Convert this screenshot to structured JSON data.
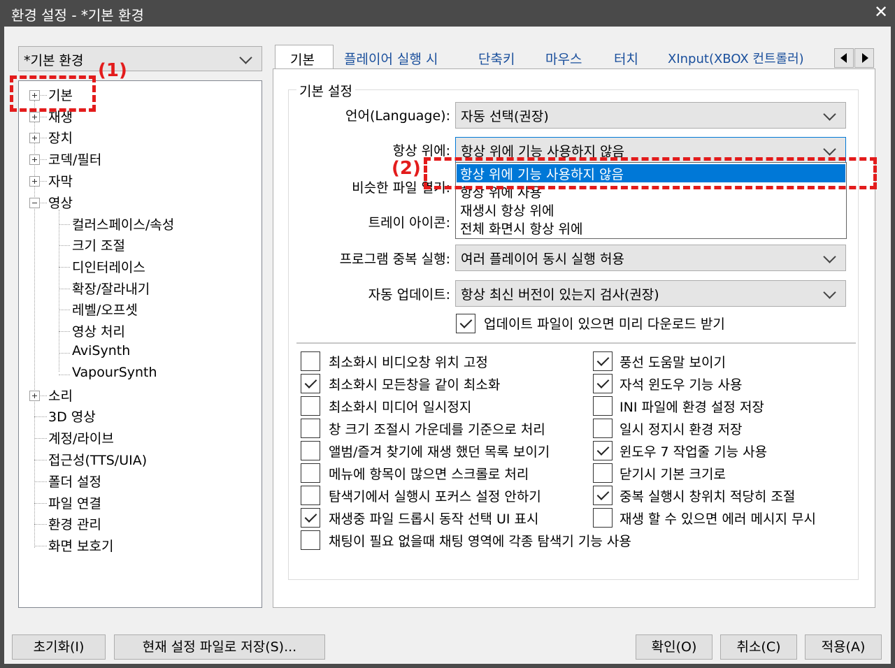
{
  "window": {
    "title": "환경 설정 - *기본 환경",
    "close_glyph": "✕"
  },
  "preset": {
    "value": "*기본 환경"
  },
  "tree": [
    {
      "label": "기본",
      "expander": "plus"
    },
    {
      "label": "재생",
      "expander": "plus"
    },
    {
      "label": "장치",
      "expander": "plus"
    },
    {
      "label": "코덱/필터",
      "expander": "plus"
    },
    {
      "label": "자막",
      "expander": "plus"
    },
    {
      "label": "영상",
      "expander": "minus"
    },
    {
      "label": "컬러스페이스/속성",
      "expander": "none"
    },
    {
      "label": "크기 조절",
      "expander": "none"
    },
    {
      "label": "디인터레이스",
      "expander": "none"
    },
    {
      "label": "확장/잘라내기",
      "expander": "none"
    },
    {
      "label": "레벨/오프셋",
      "expander": "none"
    },
    {
      "label": "영상 처리",
      "expander": "none"
    },
    {
      "label": "AviSynth",
      "expander": "none"
    },
    {
      "label": "VapourSynth",
      "expander": "none"
    },
    {
      "label": "소리",
      "expander": "plus"
    },
    {
      "label": "3D 영상",
      "expander": "none"
    },
    {
      "label": "계정/라이브",
      "expander": "none"
    },
    {
      "label": "접근성(TTS/UIA)",
      "expander": "none"
    },
    {
      "label": "폴더 설정",
      "expander": "none"
    },
    {
      "label": "파일 연결",
      "expander": "none"
    },
    {
      "label": "환경 관리",
      "expander": "none"
    },
    {
      "label": "화면 보호기",
      "expander": "none"
    }
  ],
  "tabs": [
    "기본",
    "플레이어 실행 시",
    "단축키",
    "마우스",
    "터치",
    "XInput(XBOX 컨트롤러)"
  ],
  "active_tab": "기본",
  "group_title": "기본 설정",
  "fields": {
    "language": {
      "label": "언어(Language):",
      "value": "자동 선택(권장)"
    },
    "always_on_top": {
      "label": "항상 위에:",
      "value": "항상 위에 기능 사용하지 않음"
    },
    "similar_files": {
      "label": "비슷한 파일 열기:"
    },
    "tray_icon": {
      "label": "트레이 아이콘:"
    },
    "multi_instance": {
      "label": "프로그램 중복 실행:",
      "value": "여러 플레이어 동시 실행 허용"
    },
    "auto_update": {
      "label": "자동 업데이트:",
      "value": "항상 최신 버전이 있는지 검사(권장)"
    },
    "predownload": {
      "label": "업데이트 파일이 있으면 미리 다운로드 받기",
      "checked": true
    }
  },
  "dropdown": {
    "options": [
      "항상 위에 기능 사용하지 않음",
      "항상 위에 사용",
      "재생시 항상 위에",
      "전체 화면시 항상 위에"
    ],
    "selected": 0
  },
  "checks_left": [
    {
      "label": "최소화시 비디오창 위치 고정",
      "checked": false
    },
    {
      "label": "최소화시 모든창을 같이 최소화",
      "checked": true
    },
    {
      "label": "최소화시 미디어 일시정지",
      "checked": false
    },
    {
      "label": "창 크기 조절시 가운데를 기준으로 처리",
      "checked": false
    },
    {
      "label": "앨범/즐겨 찾기에 재생 했던 목록 보이기",
      "checked": false
    },
    {
      "label": "메뉴에 항목이 많으면 스크롤로 처리",
      "checked": false
    },
    {
      "label": "탐색기에서 실행시 포커스 설정 안하기",
      "checked": false
    },
    {
      "label": "재생중 파일 드롭시 동작 선택 UI 표시",
      "checked": true
    },
    {
      "label": "채팅이 필요 없을때 채팅 영역에 각종 탐색기 기능 사용",
      "checked": false
    }
  ],
  "checks_right": [
    {
      "label": "풍선 도움말 보이기",
      "checked": true
    },
    {
      "label": "자석 윈도우 기능 사용",
      "checked": true
    },
    {
      "label": "INI 파일에 환경 설정 저장",
      "checked": false
    },
    {
      "label": "일시 정지시 환경 저장",
      "checked": false
    },
    {
      "label": "윈도우 7 작업줄 기능 사용",
      "checked": true
    },
    {
      "label": "닫기시 기본 크기로",
      "checked": false
    },
    {
      "label": "중복 실행시 창위치 적당히 조절",
      "checked": true
    },
    {
      "label": "재생 할 수 있으면 에러 메시지 무시",
      "checked": false
    }
  ],
  "buttons": {
    "reset": "초기화(I)",
    "save_file": "현재 설정 파일로 저장(S)...",
    "ok": "확인(O)",
    "cancel": "취소(C)",
    "apply": "적용(A)"
  },
  "annotations": {
    "a1": "(1)",
    "a2": "(2)",
    "color": "#e31c1c"
  },
  "colors": {
    "selection": "#0078d7",
    "titlebar": "#4a4a4a",
    "tab_text": "#1a4f9c"
  }
}
